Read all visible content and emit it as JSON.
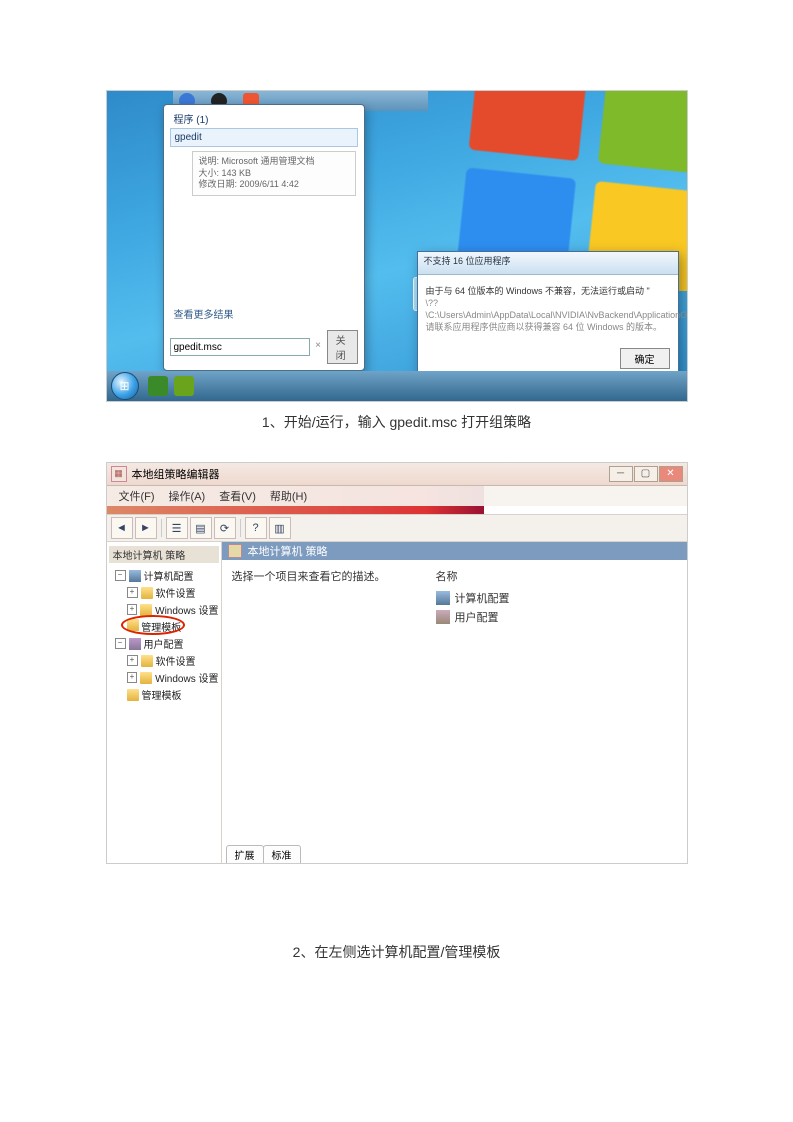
{
  "caption1": "1、开始/运行，输入 gpedit.msc 打开组策略",
  "caption2": "2、在左侧选计算机配置/管理模板",
  "startmenu": {
    "header": "程序 (1)",
    "item": "gpedit",
    "detail_line1": "说明: Microsoft 通用管理文档",
    "detail_line2": "大小: 143 KB",
    "detail_line3": "修改日期: 2009/6/11 4:42",
    "see_all": "查看更多结果",
    "input_value": "gpedit.msc",
    "close_btn": "关闭"
  },
  "dialog": {
    "title": "不支持 16 位应用程序",
    "line1": "由于与 64 位版本的 Windows 不兼容，无法运行或启动 \"",
    "line2": "\\??\\C:\\Users\\Admin\\AppData\\Local\\NVIDIA\\NvBackend\\ApplicationOntology\\NvOAWrapperCache.exe\"。请联系应用程序供应商以获得兼容 64 位 Windows 的版本。",
    "ok": "确定"
  },
  "gpedit": {
    "window_title": "本地组策略编辑器",
    "menu_file": "文件(F)",
    "menu_action": "操作(A)",
    "menu_view": "查看(V)",
    "menu_help": "帮助(H)",
    "tree_root": "本地计算机 策略",
    "tree_comp": "计算机配置",
    "tree_soft": "软件设置",
    "tree_win": "Windows 设置",
    "tree_admin": "管理模板",
    "tree_user": "用户配置",
    "right_title": "本地计算机 策略",
    "right_hint": "选择一个项目来查看它的描述。",
    "right_hdr_name": "名称",
    "right_item_comp": "计算机配置",
    "right_item_user": "用户配置",
    "tab_ext": "扩展",
    "tab_std": "标准"
  }
}
